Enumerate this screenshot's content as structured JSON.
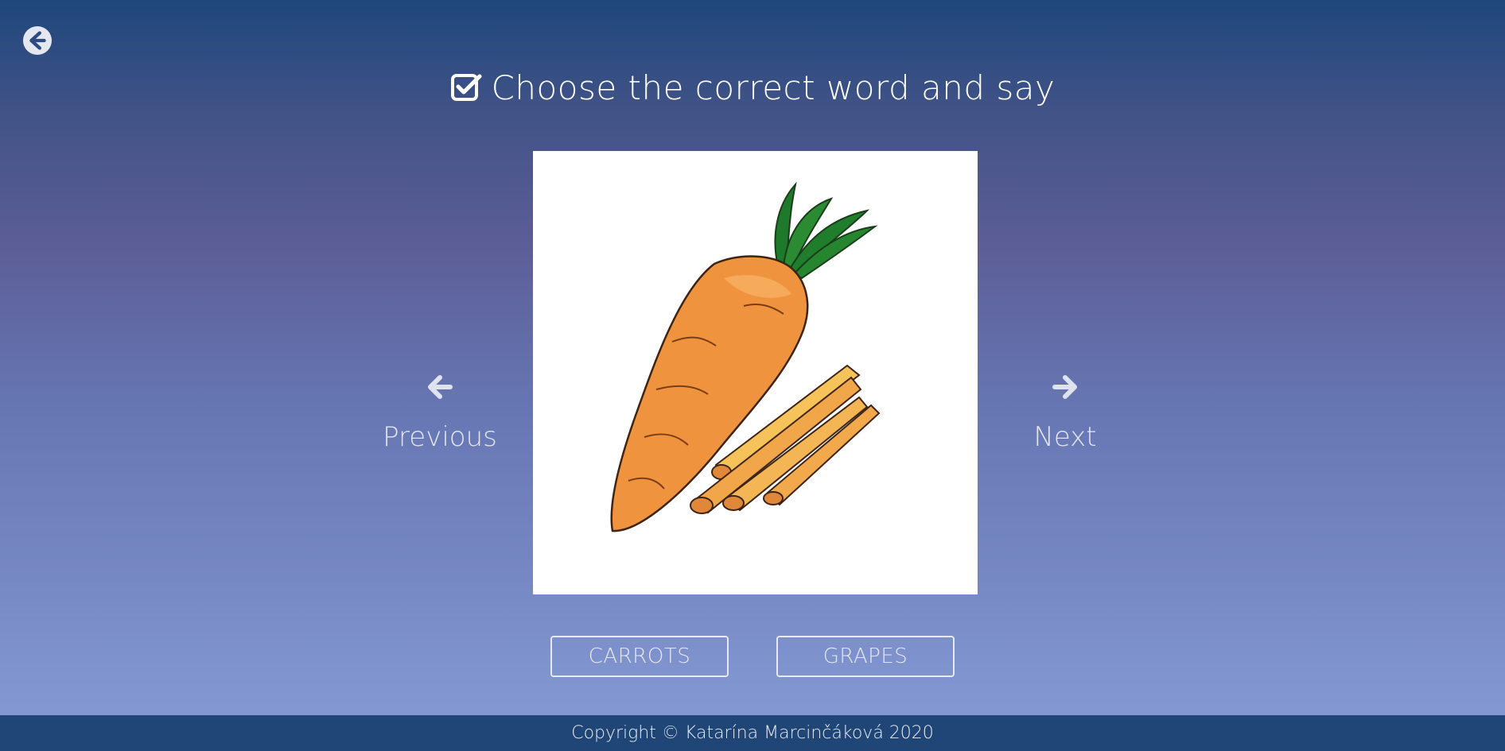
{
  "header": {
    "back_icon": "arrow-circle-left-icon",
    "title_icon": "check-square-icon",
    "title": "Choose the correct word and say"
  },
  "picture": {
    "subject": "carrot-image"
  },
  "navigation": {
    "previous_label": "Previous",
    "previous_icon": "arrow-left-icon",
    "next_label": "Next",
    "next_icon": "arrow-right-icon"
  },
  "answers": [
    {
      "label": "CARROTS"
    },
    {
      "label": "GRAPES"
    }
  ],
  "footer": {
    "copyright": "Copyright © Katarína Marcinčáková 2020"
  },
  "colors": {
    "background_top": "#1f477c",
    "background_bottom": "#879dd6",
    "footer": "#1f4677",
    "text": "#ffffff"
  }
}
